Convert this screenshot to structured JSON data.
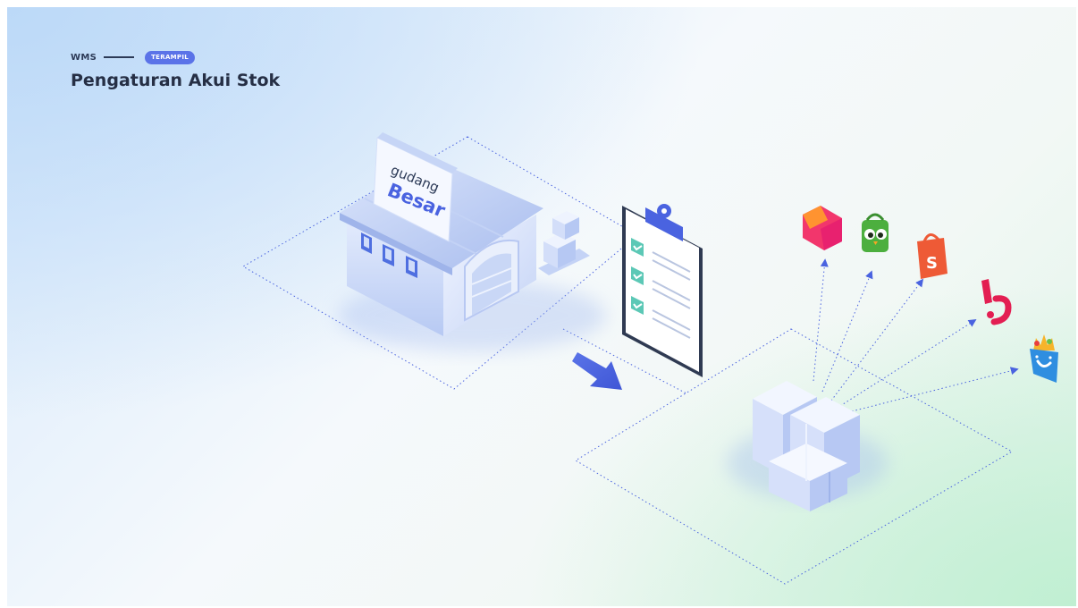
{
  "breadcrumb": {
    "module": "WMS",
    "badge": "TERAMPIL"
  },
  "title": "Pengaturan Akui Stok",
  "warehouse_sign": {
    "line1": "gudang",
    "line2": "Besar"
  },
  "icons": {
    "warehouse": "warehouse-icon",
    "clipboard": "checklist-clipboard-icon",
    "flow_arrow": "right-down-arrow-icon",
    "stock_boxes": "stacked-boxes-icon",
    "marketplaces": [
      "lazada-logo-icon",
      "tokopedia-logo-icon",
      "shopee-logo-icon",
      "bukalapak-logo-icon",
      "blibli-logo-icon"
    ]
  },
  "colors": {
    "accent": "#5b73e8",
    "title": "#262f45",
    "check": "#5cc8b6",
    "lazada": "#f2366c",
    "tokopedia": "#4caf3e",
    "shopee": "#ee5a36",
    "bukalapak": "#e31e52",
    "blibli": "#2f8ee0"
  }
}
